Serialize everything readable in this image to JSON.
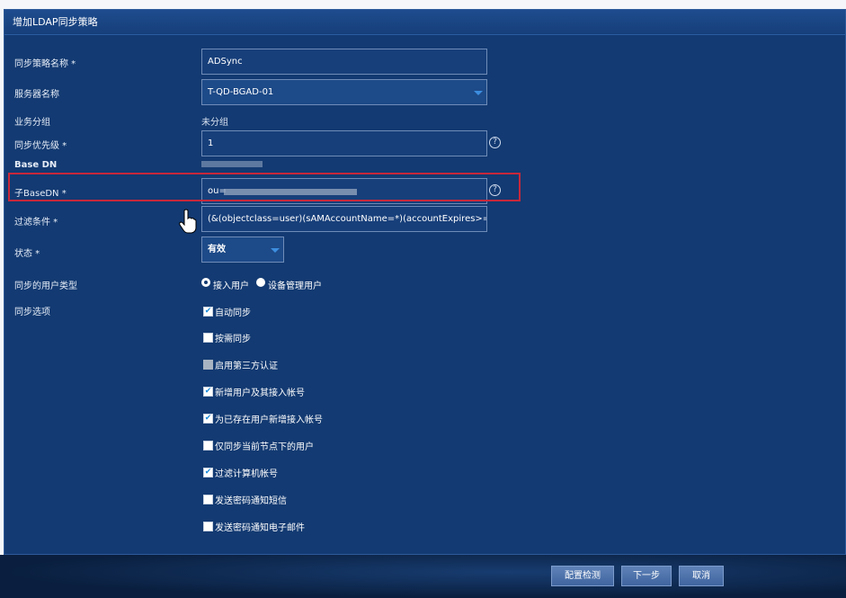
{
  "dialog": {
    "title": "增加LDAP同步策略"
  },
  "form": {
    "policy_name": {
      "label": "同步策略名称 *",
      "value": "ADSync"
    },
    "server_name": {
      "label": "服务器名称",
      "value": "T-QD-BGAD-01"
    },
    "business_group": {
      "label": "业务分组",
      "value": "未分组"
    },
    "sync_priority": {
      "label": "同步优先级 *",
      "value": "1"
    },
    "base_dn": {
      "label": "Base DN"
    },
    "sub_base_dn": {
      "label": "子BaseDN *",
      "value": "ou="
    },
    "filter": {
      "label": "过滤条件 *",
      "value": "(&(objectclass=user)(sAMAccountName=*)(accountExpires>=nov"
    },
    "status": {
      "label": "状态 *",
      "value": "有效"
    },
    "user_type": {
      "label": "同步的用户类型",
      "options": [
        "接入用户",
        "设备管理用户"
      ],
      "selected": "接入用户"
    },
    "sync_options": {
      "label": "同步选项",
      "items": [
        {
          "label": "自动同步",
          "checked": true
        },
        {
          "label": "按需同步",
          "checked": false
        },
        {
          "label": "启用第三方认证",
          "checked": false,
          "disabled": true
        },
        {
          "label": "新增用户及其接入帐号",
          "checked": true
        },
        {
          "label": "为已存在用户新增接入帐号",
          "checked": true
        },
        {
          "label": "仅同步当前节点下的用户",
          "checked": false
        },
        {
          "label": "过滤计算机帐号",
          "checked": true
        },
        {
          "label": "发送密码通知短信",
          "checked": false
        },
        {
          "label": "发送密码通知电子邮件",
          "checked": false
        }
      ]
    },
    "help_symbol": "?"
  },
  "footer": {
    "check_config": "配置检测",
    "next": "下一步",
    "cancel": "取消"
  },
  "colors": {
    "panel_bg": "#133a72",
    "titlebar_bg": "#1e4c8e",
    "highlight_border": "#c8283b",
    "checkbox_check": "#1a8ad8"
  }
}
